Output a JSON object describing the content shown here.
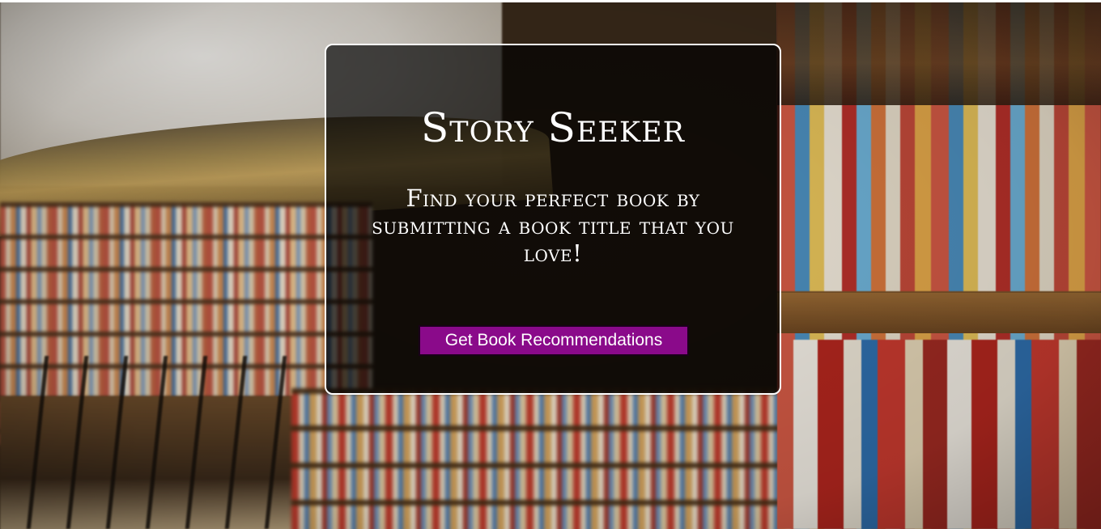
{
  "hero": {
    "title": "Story Seeker",
    "subtitle": "Find your perfect book by submitting a book title that you love!",
    "cta_label": "Get Book Recommendations"
  },
  "colors": {
    "cta_background": "#8a0a8a",
    "card_background": "rgba(0,0,0,0.68)",
    "card_border": "#ffffff",
    "text": "#ffffff"
  },
  "background": {
    "description_icon": "library-bookshelves-photo"
  }
}
